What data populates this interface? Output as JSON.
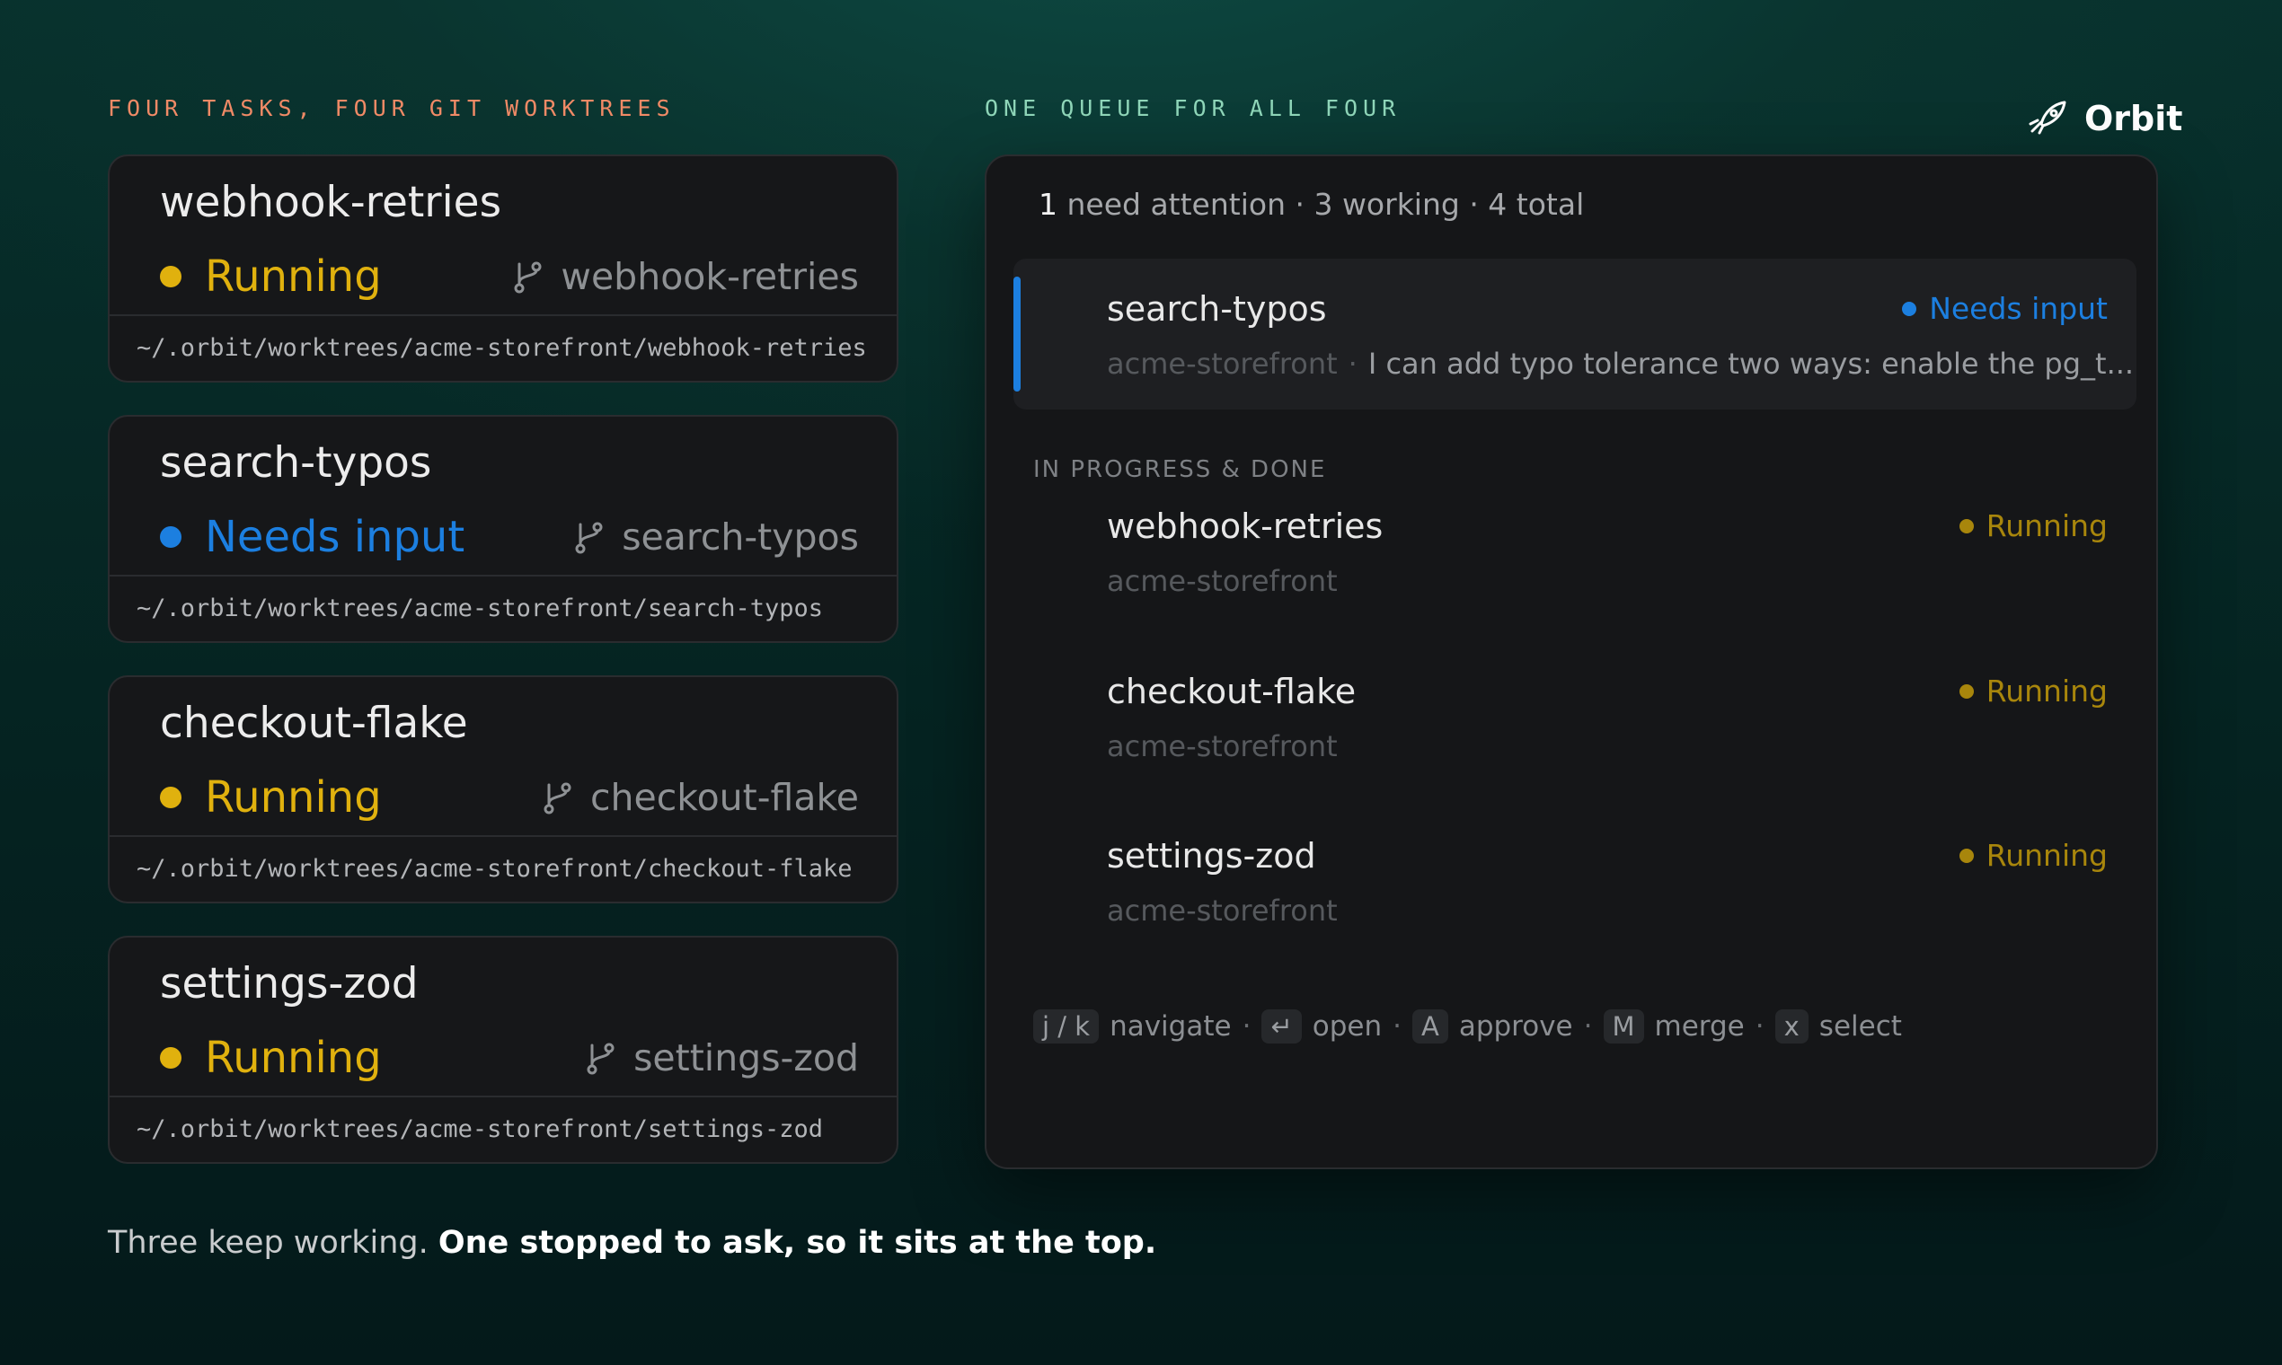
{
  "left_label": "FOUR TASKS, FOUR GIT WORKTREES",
  "right_label": "ONE QUEUE FOR ALL FOUR",
  "brand": {
    "name": "Orbit",
    "icon": "rocket-icon"
  },
  "colors": {
    "running": "#e0b10e",
    "needs_input": "#1c7fe0",
    "running_dim": "#a8860c"
  },
  "worktrees": [
    {
      "title": "webhook-retries",
      "status": "Running",
      "status_type": "running",
      "branch": "webhook-retries",
      "path": "~/.orbit/worktrees/acme-storefront/webhook-retries"
    },
    {
      "title": "search-typos",
      "status": "Needs input",
      "status_type": "needs_input",
      "branch": "search-typos",
      "path": "~/.orbit/worktrees/acme-storefront/search-typos"
    },
    {
      "title": "checkout-flake",
      "status": "Running",
      "status_type": "running",
      "branch": "checkout-flake",
      "path": "~/.orbit/worktrees/acme-storefront/checkout-flake"
    },
    {
      "title": "settings-zod",
      "status": "Running",
      "status_type": "running",
      "branch": "settings-zod",
      "path": "~/.orbit/worktrees/acme-storefront/settings-zod"
    }
  ],
  "queue": {
    "summary_count": "1",
    "summary_rest": "need attention · 3 working · 4 total",
    "attention": {
      "title": "search-typos",
      "status": "Needs input",
      "repo": "acme-storefront",
      "separator": "·",
      "message": "I can add typo tolerance two ways: enable the pg_t..."
    },
    "progress_label": "IN PROGRESS & DONE",
    "items": [
      {
        "title": "webhook-retries",
        "repo": "acme-storefront",
        "status": "Running"
      },
      {
        "title": "checkout-flake",
        "repo": "acme-storefront",
        "status": "Running"
      },
      {
        "title": "settings-zod",
        "repo": "acme-storefront",
        "status": "Running"
      }
    ],
    "hints": [
      {
        "key": "j / k",
        "label": "navigate"
      },
      {
        "key": "↵",
        "label": "open"
      },
      {
        "key": "A",
        "label": "approve"
      },
      {
        "key": "M",
        "label": "merge"
      },
      {
        "key": "x",
        "label": "select"
      }
    ],
    "hint_separator": "·"
  },
  "caption": {
    "plain": "Three keep working. ",
    "bold": "One stopped to ask, so it sits at the top."
  }
}
